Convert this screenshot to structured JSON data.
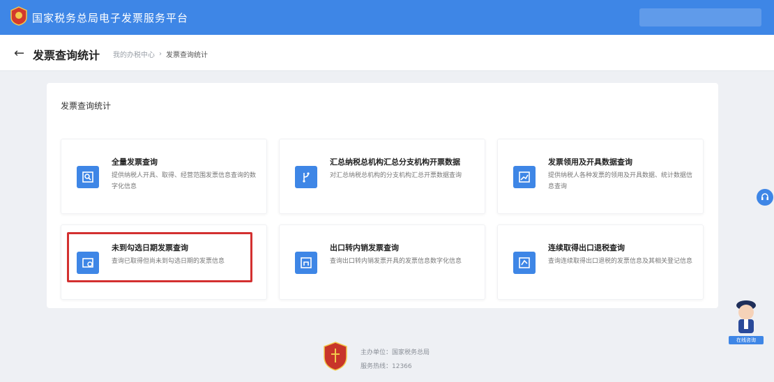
{
  "header": {
    "platform_title": "国家税务总局电子发票服务平台"
  },
  "subheader": {
    "back_icon": "arrow-left-icon",
    "title": "发票查询统计",
    "breadcrumb": [
      "我的办税中心",
      "发票查询统计"
    ],
    "separator": "›"
  },
  "main": {
    "section_title": "发票查询统计",
    "tiles": [
      {
        "title": "全量发票查询",
        "desc": "提供纳税人开具、取得、经营范围发票信息查询的数字化信息",
        "icon": "search-doc-icon"
      },
      {
        "title": "汇总纳税总机构汇总分支机构开票数据",
        "desc": "对汇总纳税总机构的分支机构汇总开票数据查询",
        "icon": "branch-icon"
      },
      {
        "title": "发票领用及开具数据查询",
        "desc": "提供纳税人各种发票的领用及开具数据、统计数据信息查询",
        "icon": "chart-doc-icon"
      },
      {
        "title": "未到勾选日期发票查询",
        "desc": "查询已取得但尚未到勾选日期的发票信息",
        "icon": "calendar-doc-icon"
      },
      {
        "title": "出口转内销发票查询",
        "desc": "查询出口转内销发票开具的发票信息数字化信息",
        "icon": "export-doc-icon"
      },
      {
        "title": "连续取得出口退税查询",
        "desc": "查询连续取得出口退税的发票信息及其相关登记信息",
        "icon": "refund-doc-icon"
      }
    ]
  },
  "widgets": {
    "support_icon": "headset-icon",
    "assistant_label": "在线咨询"
  },
  "footer": {
    "line1": "主办单位：国家税务总局",
    "line2": "服务热线：12366"
  },
  "colors": {
    "primary": "#3e86e6",
    "highlight": "#d33030"
  }
}
